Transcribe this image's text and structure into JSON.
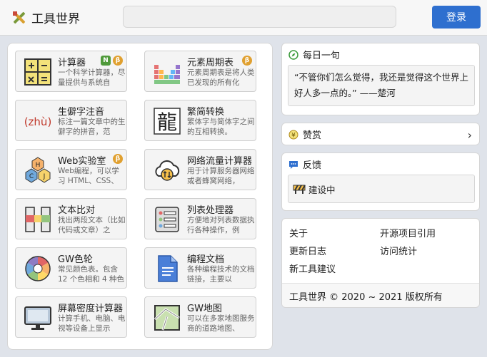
{
  "header": {
    "brand": "工具世界",
    "search_placeholder": "",
    "login_label": "登录"
  },
  "tools": [
    {
      "title": "计算器",
      "desc": "一个科学计算器，尽量提供与系统自",
      "icon": "calculator-icon",
      "badges": [
        "new",
        "beta"
      ]
    },
    {
      "title": "元素周期表",
      "desc": "元素周期表是将人类已发现的所有化",
      "icon": "periodic-table-icon",
      "badges": [
        "beta"
      ]
    },
    {
      "title": "生僻字注音",
      "desc": "标注一篇文章中的生僻字的拼音，范",
      "icon": "pinyin-icon",
      "badges": []
    },
    {
      "title": "繁简转换",
      "desc": "繁体字与简体字之间的互相转换。",
      "icon": "traditional-chinese-icon",
      "badges": []
    },
    {
      "title": "Web实验室",
      "desc": "Web编程，可以学习 HTML、CSS、",
      "icon": "web-lab-icon",
      "badges": [
        "beta"
      ]
    },
    {
      "title": "网络流量计算器",
      "desc": "用于计算服务器网络或者蜂窝网络，",
      "icon": "cloud-traffic-icon",
      "badges": []
    },
    {
      "title": "文本比对",
      "desc": "找出两段文本（比如代码或文章）之",
      "icon": "text-diff-icon",
      "badges": []
    },
    {
      "title": "列表处理器",
      "desc": "方便地对列表数据执行各种操作，例",
      "icon": "list-processor-icon",
      "badges": []
    },
    {
      "title": "GW色轮",
      "desc": "常见颜色表。包含 12 个色相和 4 种色",
      "icon": "color-wheel-icon",
      "badges": []
    },
    {
      "title": "编程文档",
      "desc": "各种编程技术的文档链接，主要以",
      "icon": "document-icon",
      "badges": []
    },
    {
      "title": "屏幕密度计算器",
      "desc": "计算手机、电脑、电视等设备上显示",
      "icon": "monitor-icon",
      "badges": []
    },
    {
      "title": "GW地图",
      "desc": "可以在多家地图服务商的道路地图、",
      "icon": "map-icon",
      "badges": []
    }
  ],
  "badge_text": {
    "new": "N",
    "beta": "β"
  },
  "daily_quote": {
    "heading": "每日一句",
    "text": "“不管你们怎么觉得，我还是觉得这个世界上好人多一点的。”  ——楚河"
  },
  "donate": {
    "label": "赞赏"
  },
  "feedback": {
    "heading": "反馈",
    "status": "建设中"
  },
  "footer_links": {
    "about": "关于",
    "open_source": "开源项目引用",
    "changelog": "更新日志",
    "stats": "访问统计",
    "suggest": "新工具建议"
  },
  "copyright": "工具世界 © 2020 ~ 2021 版权所有",
  "colors": {
    "accent": "#2e6fcf",
    "beta": "#e0a030",
    "new": "#4f9a3a"
  }
}
